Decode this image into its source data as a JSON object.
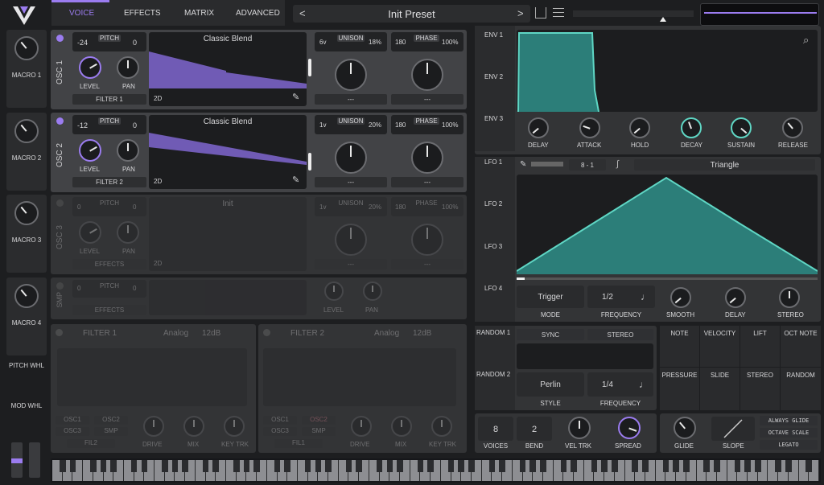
{
  "tabs": [
    "VOICE",
    "EFFECTS",
    "MATRIX",
    "ADVANCED"
  ],
  "preset": {
    "name": "Init Preset",
    "prev": "<",
    "next": ">"
  },
  "macros": [
    "MACRO 1",
    "MACRO 2",
    "MACRO 3",
    "MACRO 4"
  ],
  "wheels": [
    "PITCH WHL",
    "MOD WHL"
  ],
  "osc1": {
    "label": "OSC 1",
    "pitch": "PITCH",
    "pitch_lo": "-24",
    "pitch_hi": "0",
    "wave": "Classic Blend",
    "mode": "2D",
    "unison": "UNISON",
    "unison_v": "6v",
    "unison_pct": "18%",
    "phase": "PHASE",
    "phase_v": "180",
    "phase_pct": "100%",
    "level": "LEVEL",
    "pan": "PAN",
    "dest": "FILTER 1",
    "dash1": "---",
    "dash2": "---"
  },
  "osc2": {
    "label": "OSC 2",
    "pitch": "PITCH",
    "pitch_lo": "-12",
    "pitch_hi": "0",
    "wave": "Classic Blend",
    "mode": "2D",
    "unison": "UNISON",
    "unison_v": "1v",
    "unison_pct": "20%",
    "phase": "PHASE",
    "phase_v": "180",
    "phase_pct": "100%",
    "level": "LEVEL",
    "pan": "PAN",
    "dest": "FILTER 2",
    "dash1": "---",
    "dash2": "---"
  },
  "osc3": {
    "label": "OSC 3",
    "pitch": "PITCH",
    "pitch_lo": "0",
    "pitch_hi": "0",
    "wave": "Init",
    "mode": "2D",
    "unison": "UNISON",
    "unison_v": "1v",
    "unison_pct": "20%",
    "phase": "PHASE",
    "phase_v": "180",
    "phase_pct": "100%",
    "level": "LEVEL",
    "pan": "PAN",
    "dest": "EFFECTS",
    "dash1": "---",
    "dash2": "---"
  },
  "smp": {
    "label": "SMP",
    "pitch": "PITCH",
    "pitch_lo": "0",
    "pitch_hi": "0",
    "level": "LEVEL",
    "pan": "PAN",
    "dest": "EFFECTS"
  },
  "filter1": {
    "label": "FILTER 1",
    "type": "Analog",
    "slope": "12dB",
    "osc1": "OSC1",
    "osc2": "OSC2",
    "osc3": "OSC3",
    "smp": "SMP",
    "fil": "FIL2",
    "drive": "DRIVE",
    "mix": "MIX",
    "keytrk": "KEY TRK"
  },
  "filter2": {
    "label": "FILTER 2",
    "type": "Analog",
    "slope": "12dB",
    "osc1": "OSC1",
    "osc2": "OSC2",
    "osc3": "OSC3",
    "smp": "SMP",
    "fil": "FIL1",
    "drive": "DRIVE",
    "mix": "MIX",
    "keytrk": "KEY TRK"
  },
  "env": {
    "tabs": [
      "ENV 1",
      "ENV 2",
      "ENV 3"
    ],
    "knobs": [
      "DELAY",
      "ATTACK",
      "HOLD",
      "DECAY",
      "SUSTAIN",
      "RELEASE"
    ]
  },
  "lfo": {
    "tabs": [
      "LFO 1",
      "LFO 2",
      "LFO 3",
      "LFO 4"
    ],
    "grid": "8 - 1",
    "shape": "Triangle",
    "mode_v": "Trigger",
    "mode": "MODE",
    "freq_v": "1/2",
    "freq": "FREQUENCY",
    "smooth": "SMOOTH",
    "delay": "DELAY",
    "stereo": "STEREO"
  },
  "random": {
    "tabs": [
      "RANDOM 1",
      "RANDOM 2"
    ],
    "sync": "SYNC",
    "stereo": "STEREO",
    "style_v": "Perlin",
    "style": "STYLE",
    "freq_v": "1/4",
    "freq": "FREQUENCY"
  },
  "mods": [
    "NOTE",
    "VELOCITY",
    "LIFT",
    "OCT NOTE",
    "PRESSURE",
    "SLIDE",
    "STEREO",
    "RANDOM"
  ],
  "voice": {
    "voices_v": "8",
    "voices": "VOICES",
    "bend_v": "2",
    "bend": "BEND",
    "veltrk": "VEL TRK",
    "spread": "SPREAD"
  },
  "glide": {
    "glide": "GLIDE",
    "slope": "SLOPE",
    "always": "ALWAYS GLIDE",
    "octave": "OCTAVE SCALE",
    "legato": "LEGATO"
  },
  "colors": {
    "accent": "#9b7cf0",
    "teal": "#5fd6c4",
    "panel": "#424346"
  }
}
